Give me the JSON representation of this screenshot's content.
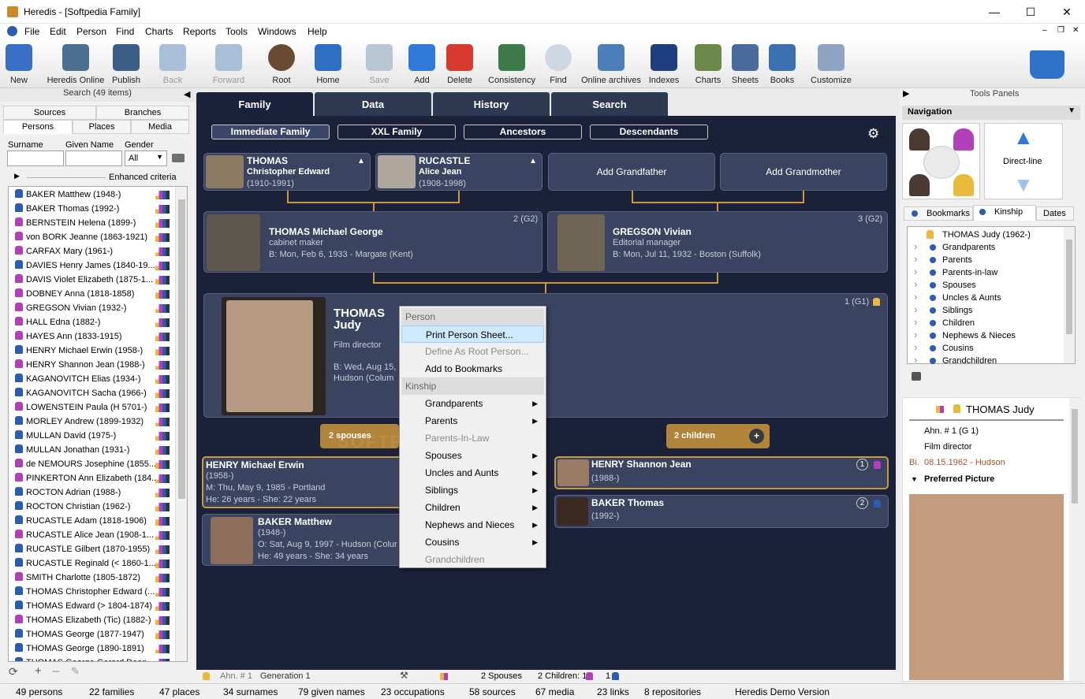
{
  "window": {
    "title": "Heredis - [Softpedia Family]"
  },
  "menu": [
    "File",
    "Edit",
    "Person",
    "Find",
    "Charts",
    "Reports",
    "Tools",
    "Windows",
    "Help"
  ],
  "toolbar": [
    {
      "label": "New",
      "icon": "new-icon",
      "enabled": true
    },
    {
      "label": "Heredis Online",
      "icon": "heredis-online-icon",
      "enabled": true
    },
    {
      "label": "Publish",
      "icon": "publish-icon",
      "enabled": true
    },
    {
      "label": "Back",
      "icon": "back-arrow-icon",
      "enabled": false
    },
    {
      "label": "Forward",
      "icon": "forward-arrow-icon",
      "enabled": false
    },
    {
      "label": "Root",
      "icon": "root-person-icon",
      "enabled": true
    },
    {
      "label": "Home",
      "icon": "home-icon",
      "enabled": true
    },
    {
      "label": "Save",
      "icon": "save-icon",
      "enabled": false
    },
    {
      "label": "Add",
      "icon": "add-icon",
      "enabled": true
    },
    {
      "label": "Delete",
      "icon": "delete-icon",
      "enabled": true
    },
    {
      "label": "Consistency",
      "icon": "consistency-icon",
      "enabled": true
    },
    {
      "label": "Find",
      "icon": "find-icon",
      "enabled": true
    },
    {
      "label": "Online archives",
      "icon": "online-archives-icon",
      "enabled": true
    },
    {
      "label": "Indexes",
      "icon": "indexes-icon",
      "enabled": true
    },
    {
      "label": "Charts",
      "icon": "charts-tree-icon",
      "enabled": true
    },
    {
      "label": "Sheets",
      "icon": "sheets-icon",
      "enabled": true
    },
    {
      "label": "Books",
      "icon": "books-icon",
      "enabled": true
    },
    {
      "label": "Customize",
      "icon": "customize-icon",
      "enabled": true
    }
  ],
  "left": {
    "header": "Search (49 items)",
    "tabs_top": [
      "Sources",
      "Branches"
    ],
    "tabs_bottom": [
      "Persons",
      "Places",
      "Media"
    ],
    "surname_label": "Surname",
    "given_label": "Given Name",
    "gender_label": "Gender",
    "gender_value": "All",
    "enhanced": "Enhanced criteria",
    "persons": [
      {
        "n": "BAKER Matthew (1948-)",
        "s": "m"
      },
      {
        "n": "BAKER Thomas (1992-)",
        "s": "m"
      },
      {
        "n": "BERNSTEIN Helena (1899-)",
        "s": "f"
      },
      {
        "n": "von BORK Jeanne (1863-1921)",
        "s": "f"
      },
      {
        "n": "CARFAX Mary (1961-)",
        "s": "f"
      },
      {
        "n": "DAVIES Henry James (1840-19...",
        "s": "m"
      },
      {
        "n": "DAVIS Violet Elizabeth (1875-1...",
        "s": "f"
      },
      {
        "n": "DOBNEY Anna (1818-1858)",
        "s": "f"
      },
      {
        "n": "GREGSON Vivian (1932-)",
        "s": "f"
      },
      {
        "n": "HALL Edna (1882-)",
        "s": "f"
      },
      {
        "n": "HAYES Ann (1833-1915)",
        "s": "f"
      },
      {
        "n": "HENRY Michael Erwin (1958-)",
        "s": "m"
      },
      {
        "n": "HENRY Shannon Jean (1988-)",
        "s": "f"
      },
      {
        "n": "KAGANOVITCH Elias (1934-)",
        "s": "m"
      },
      {
        "n": "KAGANOVITCH Sacha (1966-)",
        "s": "m"
      },
      {
        "n": "LOWENSTEIN Paula (H 5701-)",
        "s": "f"
      },
      {
        "n": "MORLEY Andrew (1899-1932)",
        "s": "m"
      },
      {
        "n": "MULLAN David (1975-)",
        "s": "m"
      },
      {
        "n": "MULLAN Jonathan (1931-)",
        "s": "m"
      },
      {
        "n": "de NEMOURS Josephine (1855...",
        "s": "f"
      },
      {
        "n": "PINKERTON Ann Elizabeth (184...",
        "s": "f"
      },
      {
        "n": "ROCTON Adrian (1988-)",
        "s": "m"
      },
      {
        "n": "ROCTON Christian (1962-)",
        "s": "m"
      },
      {
        "n": "RUCASTLE Adam (1818-1906)",
        "s": "m"
      },
      {
        "n": "RUCASTLE Alice Jean (1908-1...",
        "s": "f"
      },
      {
        "n": "RUCASTLE Gilbert (1870-1955)",
        "s": "m"
      },
      {
        "n": "RUCASTLE Reginald (< 1860-1...",
        "s": "m"
      },
      {
        "n": "SMITH Charlotte (1805-1872)",
        "s": "f"
      },
      {
        "n": "THOMAS Christopher Edward (...",
        "s": "m"
      },
      {
        "n": "THOMAS Edward (> 1804-1874)",
        "s": "m"
      },
      {
        "n": "THOMAS Elizabeth (Tic) (1882-)",
        "s": "f"
      },
      {
        "n": "THOMAS George (1877-1947)",
        "s": "m"
      },
      {
        "n": "THOMAS George (1890-1891)",
        "s": "m"
      },
      {
        "n": "THOMAS George Gerard Dean...",
        "s": "m"
      }
    ]
  },
  "tabs": [
    "Family",
    "Data",
    "History",
    "Search"
  ],
  "subtabs": [
    "Immediate Family",
    "XXL Family",
    "Ancestors",
    "Descendants"
  ],
  "grandparents": [
    {
      "line1": "THOMAS",
      "line2": "Christopher Edward",
      "dates": "(1910-1991)"
    },
    {
      "line1": "RUCASTLE",
      "line2": "Alice Jean",
      "dates": "(1908-1998)"
    }
  ],
  "add_grandfather": "Add Grandfather",
  "add_grandmother": "Add Grandmother",
  "parents": [
    {
      "name": "THOMAS Michael George",
      "job": "cabinet maker",
      "birth": "B: Mon, Feb 6, 1933 - Margate (Kent)",
      "gen": "2 (G2)"
    },
    {
      "name": "GREGSON Vivian",
      "job": "Editorial manager",
      "birth": "B: Mon, Jul 11, 1932 - Boston (Suffolk)",
      "gen": "3 (G2)"
    }
  ],
  "root": {
    "surname": "THOMAS",
    "given": "Judy",
    "job": "Film director",
    "birth1": "B: Wed, Aug 15,",
    "birth2": "Hudson (Colum",
    "gen": "1 (G1)"
  },
  "spouses_badge": "2 spouses",
  "children_badge": "2 children",
  "spouses": [
    {
      "name": "HENRY Michael Erwin",
      "dates": "(1958-)",
      "m": "M: Thu, May 9, 1985 - Portland",
      "age": "He: 26 years - She: 22 years"
    },
    {
      "name": "BAKER Matthew",
      "dates": "(1948-)",
      "m": "O: Sat, Aug 9, 1997 - Hudson (Colur",
      "age": "He: 49 years - She: 34 years"
    }
  ],
  "children": [
    {
      "name": "HENRY Shannon Jean",
      "dates": "(1988-)",
      "num": "1"
    },
    {
      "name": "BAKER Thomas",
      "dates": "(1992-)",
      "num": "2"
    }
  ],
  "context_menu": {
    "header1": "Person",
    "items1": [
      {
        "t": "Print Person Sheet...",
        "st": "hl"
      },
      {
        "t": "Define As Root Person...",
        "st": "dis"
      },
      {
        "t": "Add to Bookmarks",
        "st": ""
      }
    ],
    "header2": "Kinship",
    "items2": [
      {
        "t": "Grandparents",
        "st": "",
        "sub": true
      },
      {
        "t": "Parents",
        "st": "",
        "sub": true
      },
      {
        "t": "Parents-In-Law",
        "st": "dis",
        "sub": false
      },
      {
        "t": "Spouses",
        "st": "",
        "sub": true
      },
      {
        "t": "Uncles and Aunts",
        "st": "",
        "sub": true
      },
      {
        "t": "Siblings",
        "st": "",
        "sub": true
      },
      {
        "t": "Children",
        "st": "",
        "sub": true
      },
      {
        "t": "Nephews and Nieces",
        "st": "",
        "sub": true
      },
      {
        "t": "Cousins",
        "st": "",
        "sub": true
      },
      {
        "t": "Grandchildren",
        "st": "dis",
        "sub": false
      }
    ]
  },
  "bottom": {
    "ahn": "Ahn. # 1",
    "generation": "Generation 1",
    "spouses": "2 Spouses",
    "children": "2 Children: 1",
    "children2": "1"
  },
  "right": {
    "header": "Tools Panels",
    "nav": "Navigation",
    "direct_line": "Direct-line",
    "tabs": [
      "Bookmarks",
      "Kinship",
      "Dates"
    ],
    "kinship": [
      "THOMAS Judy (1962-)",
      "Grandparents",
      "Parents",
      "Parents-in-law",
      "Spouses",
      "Uncles & Aunts",
      "Siblings",
      "Children",
      "Nephews & Nieces",
      "Cousins",
      "Grandchildren"
    ],
    "person_name": "THOMAS Judy",
    "ahn": "Ahn. # 1 (G 1)",
    "job": "Film director",
    "bi_label": "Bi.",
    "birth": "08.15.1962 - Hudson",
    "preferred": "Preferred Picture"
  },
  "status": [
    "49 persons",
    "22 families",
    "47 places",
    "34 surnames",
    "79 given names",
    "23  occupations",
    "58 sources",
    "67  media",
    "23 links",
    "8 repositories",
    "Heredis Demo Version"
  ],
  "colors": {
    "canvas": "#1b2138",
    "card": "#3a4460",
    "gold": "#c99a3b",
    "male": "#2a5db0",
    "female": "#b23fb8"
  }
}
